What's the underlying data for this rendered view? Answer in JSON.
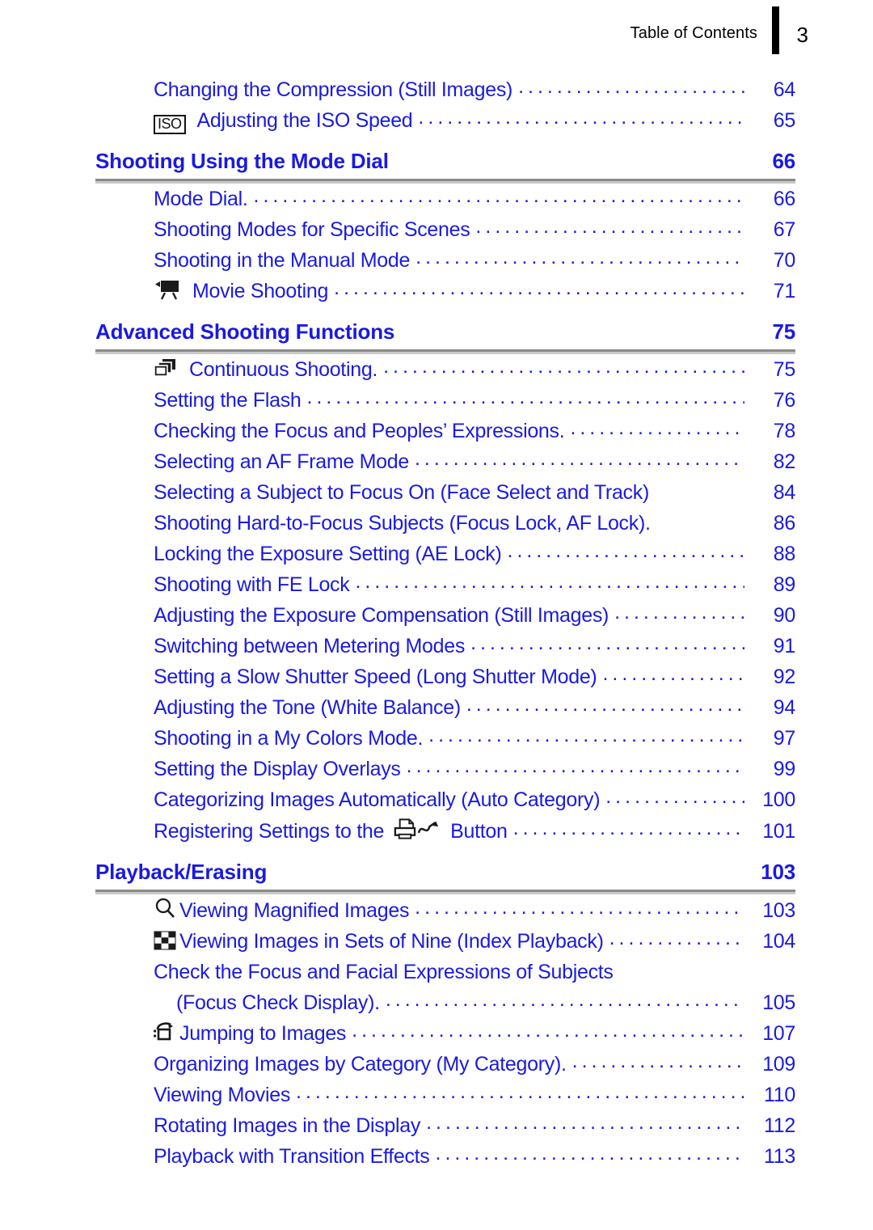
{
  "runhead": {
    "title": "Table of Contents",
    "page_number": "3"
  },
  "colors": {
    "link_blue": "#1a1ae0",
    "rule_gray": "#8a8a8a",
    "text_black": "#000000"
  },
  "toc": {
    "blocks": [
      {
        "type": "entries",
        "entries": [
          {
            "icon": "",
            "label": "Changing the Compression (Still Images)",
            "page": "64",
            "leader": true
          },
          {
            "icon": "iso-icon",
            "label": "Adjusting the ISO Speed",
            "page": "65",
            "leader": true
          }
        ]
      },
      {
        "type": "chapter",
        "title": "Shooting Using the Mode Dial",
        "page": "66"
      },
      {
        "type": "entries",
        "entries": [
          {
            "icon": "",
            "label": "Mode Dial.",
            "page": "66",
            "leader": true
          },
          {
            "icon": "",
            "label": "Shooting Modes for Specific Scenes",
            "page": "67",
            "leader": true
          },
          {
            "icon": "",
            "label": "Shooting in the Manual Mode",
            "page": "70",
            "leader": true
          },
          {
            "icon": "movie-camera-icon",
            "label": "Movie Shooting",
            "page": "71",
            "leader": true
          }
        ]
      },
      {
        "type": "chapter",
        "title": "Advanced Shooting Functions",
        "page": "75"
      },
      {
        "type": "entries",
        "entries": [
          {
            "icon": "continuous-shooting-icon",
            "label": "Continuous Shooting.",
            "page": "75",
            "leader": true
          },
          {
            "icon": "",
            "label": "Setting the Flash",
            "page": "76",
            "leader": true
          },
          {
            "icon": "",
            "label": "Checking the Focus and Peoples’ Expressions.",
            "page": "78",
            "leader": true
          },
          {
            "icon": "",
            "label": "Selecting an AF Frame Mode",
            "page": "82",
            "leader": true
          },
          {
            "icon": "",
            "label": "Selecting a Subject to Focus On (Face Select and Track)",
            "page": "84",
            "leader": false
          },
          {
            "icon": "",
            "label": "Shooting Hard-to-Focus Subjects (Focus Lock, AF Lock).",
            "page": "86",
            "leader": false
          },
          {
            "icon": "",
            "label": "Locking the Exposure Setting (AE Lock)",
            "page": "88",
            "leader": true
          },
          {
            "icon": "",
            "label": "Shooting with FE Lock",
            "page": "89",
            "leader": true
          },
          {
            "icon": "",
            "label": "Adjusting the Exposure Compensation (Still Images)",
            "page": "90",
            "leader": true
          },
          {
            "icon": "",
            "label": "Switching between Metering Modes",
            "page": "91",
            "leader": true
          },
          {
            "icon": "",
            "label": "Setting a Slow Shutter Speed (Long Shutter Mode)",
            "page": "92",
            "leader": true
          },
          {
            "icon": "",
            "label": "Adjusting the Tone (White Balance)",
            "page": "94",
            "leader": true
          },
          {
            "icon": "",
            "label": "Shooting in a My Colors Mode.",
            "page": "97",
            "leader": true
          },
          {
            "icon": "",
            "label": "Setting the Display Overlays",
            "page": "99",
            "leader": true
          },
          {
            "icon": "",
            "label": "Categorizing Images Automatically (Auto Category)",
            "page": "100",
            "leader": true
          },
          {
            "icon": "",
            "label_pre": "Registering Settings to the",
            "icon_mid": "print-share-icon",
            "label_post": "Button",
            "page": "101",
            "leader": true
          }
        ]
      },
      {
        "type": "chapter",
        "title": "Playback/Erasing",
        "page": "103"
      },
      {
        "type": "entries",
        "entries": [
          {
            "icon": "magnifier-icon",
            "label": "Viewing Magnified Images",
            "page": "103",
            "leader": true
          },
          {
            "icon": "index-playback-icon",
            "label": "Viewing Images in Sets of Nine (Index Playback)",
            "page": "104",
            "leader": true
          },
          {
            "icon": "",
            "label": "Check the Focus and Facial Expressions of Subjects",
            "page": "",
            "leader": false
          },
          {
            "icon": "",
            "label": "(Focus Check Display).",
            "page": "105",
            "leader": true,
            "indent": "sub"
          },
          {
            "icon": "jump-icon",
            "label": "Jumping to Images",
            "page": "107",
            "leader": true
          },
          {
            "icon": "",
            "label": "Organizing Images by Category (My Category).",
            "page": "109",
            "leader": true
          },
          {
            "icon": "",
            "label": "Viewing Movies",
            "page": "110",
            "leader": true
          },
          {
            "icon": "",
            "label": "Rotating Images in the Display",
            "page": "112",
            "leader": true
          },
          {
            "icon": "",
            "label": "Playback with Transition Effects",
            "page": "113",
            "leader": true
          }
        ]
      }
    ]
  }
}
